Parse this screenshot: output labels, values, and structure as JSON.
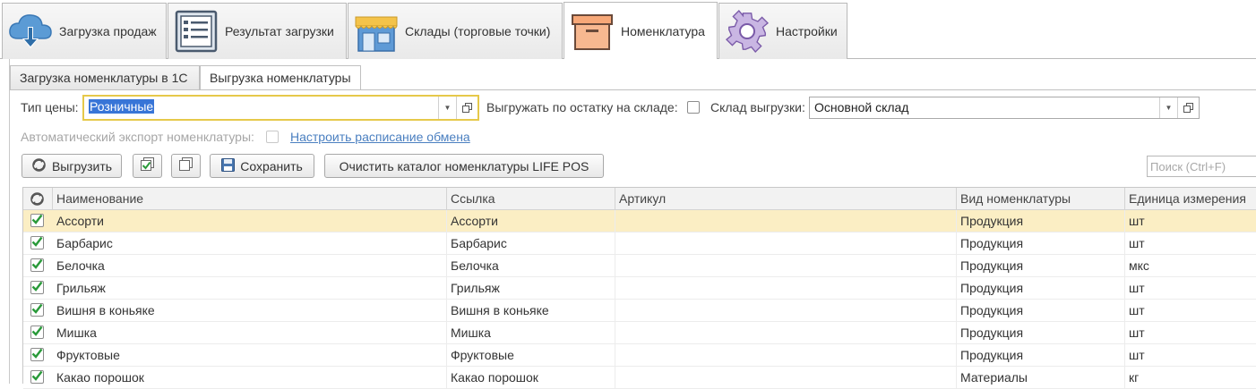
{
  "top_tabs": [
    {
      "label": "Загрузка продаж",
      "icon": "cloud-download-icon"
    },
    {
      "label": "Результат загрузки",
      "icon": "list-document-icon"
    },
    {
      "label": "Склады (торговые точки)",
      "icon": "store-icon"
    },
    {
      "label": "Номенклатура",
      "icon": "box-icon"
    },
    {
      "label": "Настройки",
      "icon": "gear-icon"
    }
  ],
  "active_top_tab": "Номенклатура",
  "sub_tabs": [
    {
      "label": "Загрузка номенклатуры в 1С"
    },
    {
      "label": "Выгрузка номенклатуры"
    }
  ],
  "active_sub_tab": "Выгрузка номенклатуры",
  "form": {
    "price_type_label": "Тип цены:",
    "price_type_value": "Розничные",
    "by_stock_label": "Выгружать по остатку на складе:",
    "by_stock_checked": false,
    "warehouse_label": "Склад выгрузки:",
    "warehouse_value": "Основной склад",
    "auto_export_label": "Автоматический экспорт номенклатуры:",
    "auto_export_checked": false,
    "schedule_link": "Настроить расписание обмена"
  },
  "toolbar": {
    "export_label": "Выгрузить",
    "save_label": "Сохранить",
    "clear_label": "Очистить каталог номенклатуры LIFE POS",
    "search_placeholder": "Поиск (Ctrl+F)"
  },
  "table": {
    "columns": [
      "Наименование",
      "Ссылка",
      "Артикул",
      "Вид номенклатуры",
      "Единица измерения"
    ],
    "rows": [
      {
        "checked": true,
        "name": "Ассорти",
        "ref": "Ассорти",
        "article": "",
        "kind": "Продукция",
        "unit": "шт"
      },
      {
        "checked": true,
        "name": "Барбарис",
        "ref": "Барбарис",
        "article": "",
        "kind": "Продукция",
        "unit": "шт"
      },
      {
        "checked": true,
        "name": "Белочка",
        "ref": "Белочка",
        "article": "",
        "kind": "Продукция",
        "unit": "мкс"
      },
      {
        "checked": true,
        "name": "Грильяж",
        "ref": "Грильяж",
        "article": "",
        "kind": "Продукция",
        "unit": "шт"
      },
      {
        "checked": true,
        "name": "Вишня в коньяке",
        "ref": "Вишня в коньяке",
        "article": "",
        "kind": "Продукция",
        "unit": "шт"
      },
      {
        "checked": true,
        "name": "Мишка",
        "ref": "Мишка",
        "article": "",
        "kind": "Продукция",
        "unit": "шт"
      },
      {
        "checked": true,
        "name": "Фруктовые",
        "ref": "Фруктовые",
        "article": "",
        "kind": "Продукция",
        "unit": "шт"
      },
      {
        "checked": true,
        "name": "Какао порошок",
        "ref": "Какао порошок",
        "article": "",
        "kind": "Материалы",
        "unit": "кг"
      }
    ],
    "selected_row": 0
  },
  "colors": {
    "selection": "#fbeec4",
    "focus": "#e6c94a",
    "check": "#2a9a3a",
    "link": "#4a7fc0"
  }
}
